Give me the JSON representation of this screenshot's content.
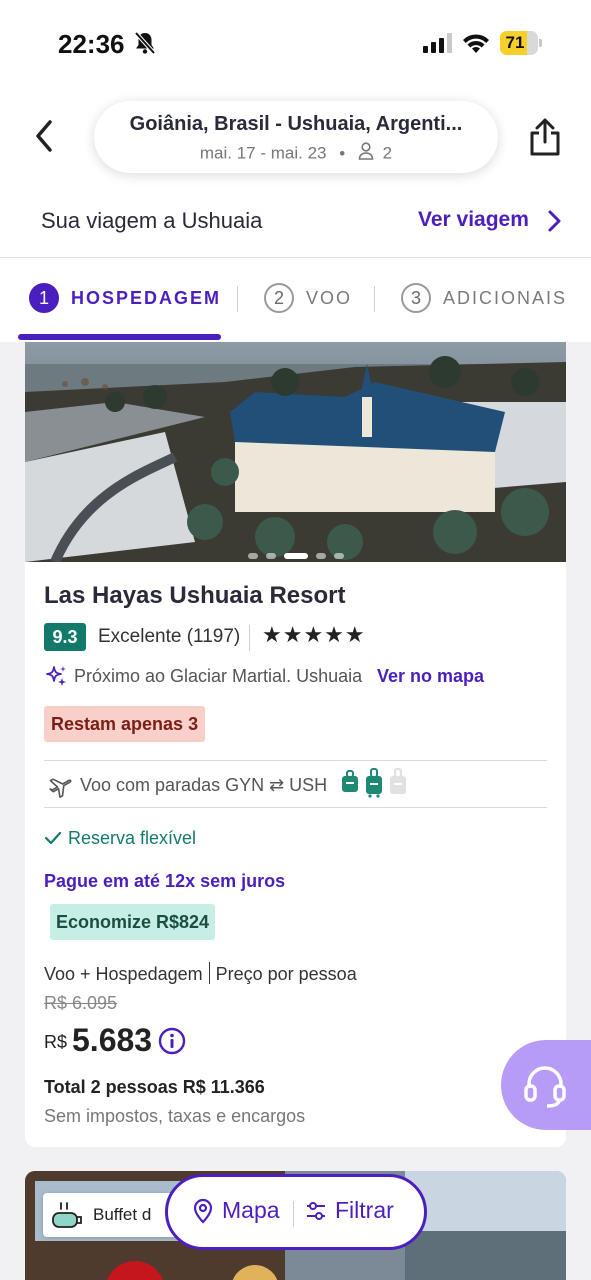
{
  "status_bar": {
    "time": "22:36",
    "battery": "71",
    "battery_level": 0.71
  },
  "header": {
    "route": "Goiânia, Brasil - Ushuaia, Argenti...",
    "dates": "mai. 17 -  mai. 23",
    "separator": "•",
    "travelers": "2",
    "trip_title": "Sua viagem a Ushuaia",
    "trip_link": "Ver viagem"
  },
  "steps": [
    {
      "number": "1",
      "label": "HOSPEDAGEM",
      "active": true
    },
    {
      "number": "2",
      "label": "VOO",
      "active": false
    },
    {
      "number": "3",
      "label": "ADICIONAIS",
      "active": false
    }
  ],
  "hotel": {
    "name": "Las Hayas Ushuaia Resort",
    "score": "9.3",
    "score_text": "Excelente (1197)",
    "stars": "★★★★★",
    "star_rating": 5,
    "location": "Próximo ao Glaciar Martial. Ushuaia",
    "map_link": "Ver no mapa",
    "scarcity": "Restam apenas 3",
    "flight": "Voo com paradas GYN ⇄ USH",
    "flexible": "Reserva flexível",
    "installments": "Pague em até 12x sem juros",
    "savings": "Economize R$824",
    "price_label_a": "Voo + Hospedagem",
    "price_label_b": "Preço por pessoa",
    "old_price": "R$ 6.095",
    "currency": "R$",
    "price": "5.683",
    "total": "Total 2 pessoas R$ 11.366",
    "taxes": "Sem impostos, taxas e encargos",
    "photo_index": 2,
    "photo_count": 5
  },
  "next_card": {
    "badge": "Buffet d"
  },
  "bottom_bar": {
    "map": "Mapa",
    "filter": "Filtrar"
  },
  "colors": {
    "brand": "#4b1fbf",
    "score": "#137a6b",
    "scarcity_bg": "#f8cfc9",
    "savings_bg": "#c6eee5",
    "fab": "#b79cf7"
  }
}
